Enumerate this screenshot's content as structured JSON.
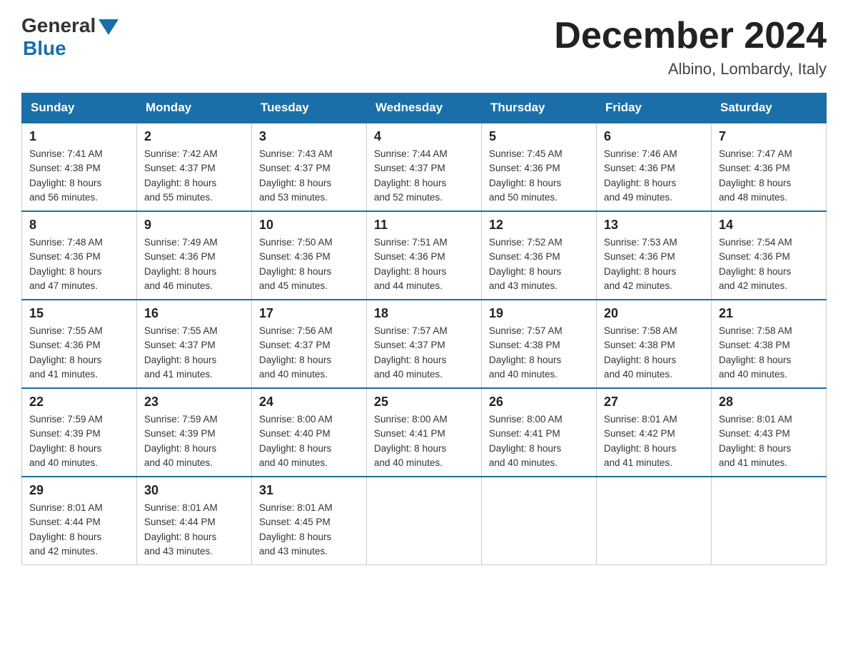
{
  "header": {
    "logo_general": "General",
    "logo_blue": "Blue",
    "month_title": "December 2024",
    "location": "Albino, Lombardy, Italy"
  },
  "days_of_week": [
    "Sunday",
    "Monday",
    "Tuesday",
    "Wednesday",
    "Thursday",
    "Friday",
    "Saturday"
  ],
  "weeks": [
    [
      {
        "day": "1",
        "sunrise": "7:41 AM",
        "sunset": "4:38 PM",
        "daylight": "8 hours and 56 minutes."
      },
      {
        "day": "2",
        "sunrise": "7:42 AM",
        "sunset": "4:37 PM",
        "daylight": "8 hours and 55 minutes."
      },
      {
        "day": "3",
        "sunrise": "7:43 AM",
        "sunset": "4:37 PM",
        "daylight": "8 hours and 53 minutes."
      },
      {
        "day": "4",
        "sunrise": "7:44 AM",
        "sunset": "4:37 PM",
        "daylight": "8 hours and 52 minutes."
      },
      {
        "day": "5",
        "sunrise": "7:45 AM",
        "sunset": "4:36 PM",
        "daylight": "8 hours and 50 minutes."
      },
      {
        "day": "6",
        "sunrise": "7:46 AM",
        "sunset": "4:36 PM",
        "daylight": "8 hours and 49 minutes."
      },
      {
        "day": "7",
        "sunrise": "7:47 AM",
        "sunset": "4:36 PM",
        "daylight": "8 hours and 48 minutes."
      }
    ],
    [
      {
        "day": "8",
        "sunrise": "7:48 AM",
        "sunset": "4:36 PM",
        "daylight": "8 hours and 47 minutes."
      },
      {
        "day": "9",
        "sunrise": "7:49 AM",
        "sunset": "4:36 PM",
        "daylight": "8 hours and 46 minutes."
      },
      {
        "day": "10",
        "sunrise": "7:50 AM",
        "sunset": "4:36 PM",
        "daylight": "8 hours and 45 minutes."
      },
      {
        "day": "11",
        "sunrise": "7:51 AM",
        "sunset": "4:36 PM",
        "daylight": "8 hours and 44 minutes."
      },
      {
        "day": "12",
        "sunrise": "7:52 AM",
        "sunset": "4:36 PM",
        "daylight": "8 hours and 43 minutes."
      },
      {
        "day": "13",
        "sunrise": "7:53 AM",
        "sunset": "4:36 PM",
        "daylight": "8 hours and 42 minutes."
      },
      {
        "day": "14",
        "sunrise": "7:54 AM",
        "sunset": "4:36 PM",
        "daylight": "8 hours and 42 minutes."
      }
    ],
    [
      {
        "day": "15",
        "sunrise": "7:55 AM",
        "sunset": "4:36 PM",
        "daylight": "8 hours and 41 minutes."
      },
      {
        "day": "16",
        "sunrise": "7:55 AM",
        "sunset": "4:37 PM",
        "daylight": "8 hours and 41 minutes."
      },
      {
        "day": "17",
        "sunrise": "7:56 AM",
        "sunset": "4:37 PM",
        "daylight": "8 hours and 40 minutes."
      },
      {
        "day": "18",
        "sunrise": "7:57 AM",
        "sunset": "4:37 PM",
        "daylight": "8 hours and 40 minutes."
      },
      {
        "day": "19",
        "sunrise": "7:57 AM",
        "sunset": "4:38 PM",
        "daylight": "8 hours and 40 minutes."
      },
      {
        "day": "20",
        "sunrise": "7:58 AM",
        "sunset": "4:38 PM",
        "daylight": "8 hours and 40 minutes."
      },
      {
        "day": "21",
        "sunrise": "7:58 AM",
        "sunset": "4:38 PM",
        "daylight": "8 hours and 40 minutes."
      }
    ],
    [
      {
        "day": "22",
        "sunrise": "7:59 AM",
        "sunset": "4:39 PM",
        "daylight": "8 hours and 40 minutes."
      },
      {
        "day": "23",
        "sunrise": "7:59 AM",
        "sunset": "4:39 PM",
        "daylight": "8 hours and 40 minutes."
      },
      {
        "day": "24",
        "sunrise": "8:00 AM",
        "sunset": "4:40 PM",
        "daylight": "8 hours and 40 minutes."
      },
      {
        "day": "25",
        "sunrise": "8:00 AM",
        "sunset": "4:41 PM",
        "daylight": "8 hours and 40 minutes."
      },
      {
        "day": "26",
        "sunrise": "8:00 AM",
        "sunset": "4:41 PM",
        "daylight": "8 hours and 40 minutes."
      },
      {
        "day": "27",
        "sunrise": "8:01 AM",
        "sunset": "4:42 PM",
        "daylight": "8 hours and 41 minutes."
      },
      {
        "day": "28",
        "sunrise": "8:01 AM",
        "sunset": "4:43 PM",
        "daylight": "8 hours and 41 minutes."
      }
    ],
    [
      {
        "day": "29",
        "sunrise": "8:01 AM",
        "sunset": "4:44 PM",
        "daylight": "8 hours and 42 minutes."
      },
      {
        "day": "30",
        "sunrise": "8:01 AM",
        "sunset": "4:44 PM",
        "daylight": "8 hours and 43 minutes."
      },
      {
        "day": "31",
        "sunrise": "8:01 AM",
        "sunset": "4:45 PM",
        "daylight": "8 hours and 43 minutes."
      },
      null,
      null,
      null,
      null
    ]
  ],
  "sunrise_label": "Sunrise:",
  "sunset_label": "Sunset:",
  "daylight_label": "Daylight:"
}
